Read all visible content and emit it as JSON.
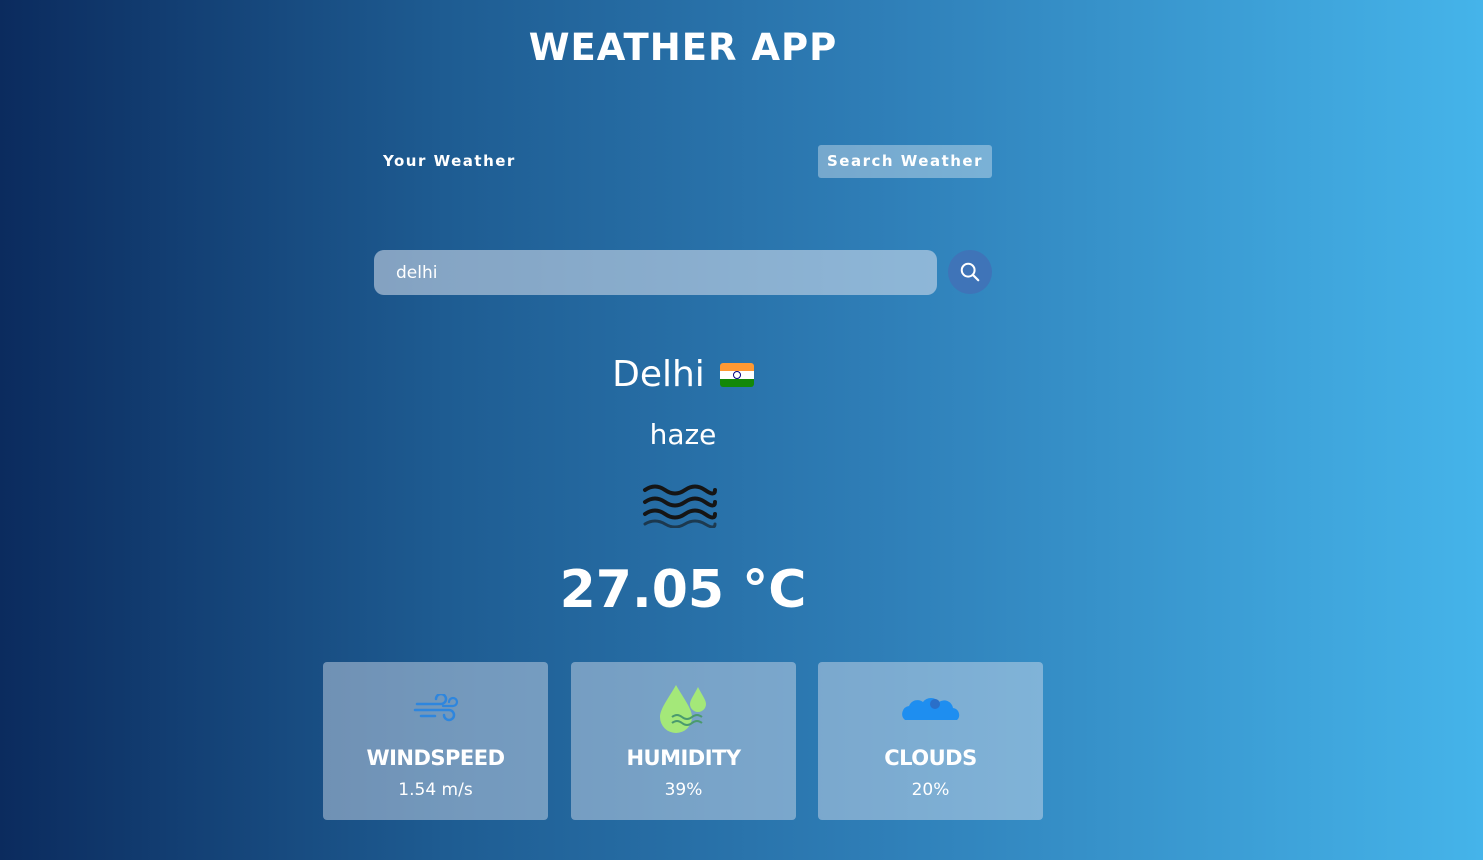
{
  "app": {
    "title": "WEATHER APP"
  },
  "tabs": [
    {
      "label": "Your Weather",
      "active": false
    },
    {
      "label": "Search Weather",
      "active": true
    }
  ],
  "search": {
    "value": "delhi",
    "icon": "search-icon"
  },
  "weather": {
    "city": "Delhi",
    "country_flag": "india-flag-icon",
    "description": "haze",
    "icon": "haze-icon",
    "temperature": "27.05 °C"
  },
  "cards": [
    {
      "label": "WINDSPEED",
      "value": "1.54 m/s",
      "icon": "wind-icon"
    },
    {
      "label": "HUMIDITY",
      "value": "39%",
      "icon": "humidity-icon"
    },
    {
      "label": "CLOUDS",
      "value": "20%",
      "icon": "cloud-icon"
    }
  ],
  "colors": {
    "background_start": "#0b2b5e",
    "background_end": "#45b4ea",
    "search_button": "#3f74b8"
  }
}
